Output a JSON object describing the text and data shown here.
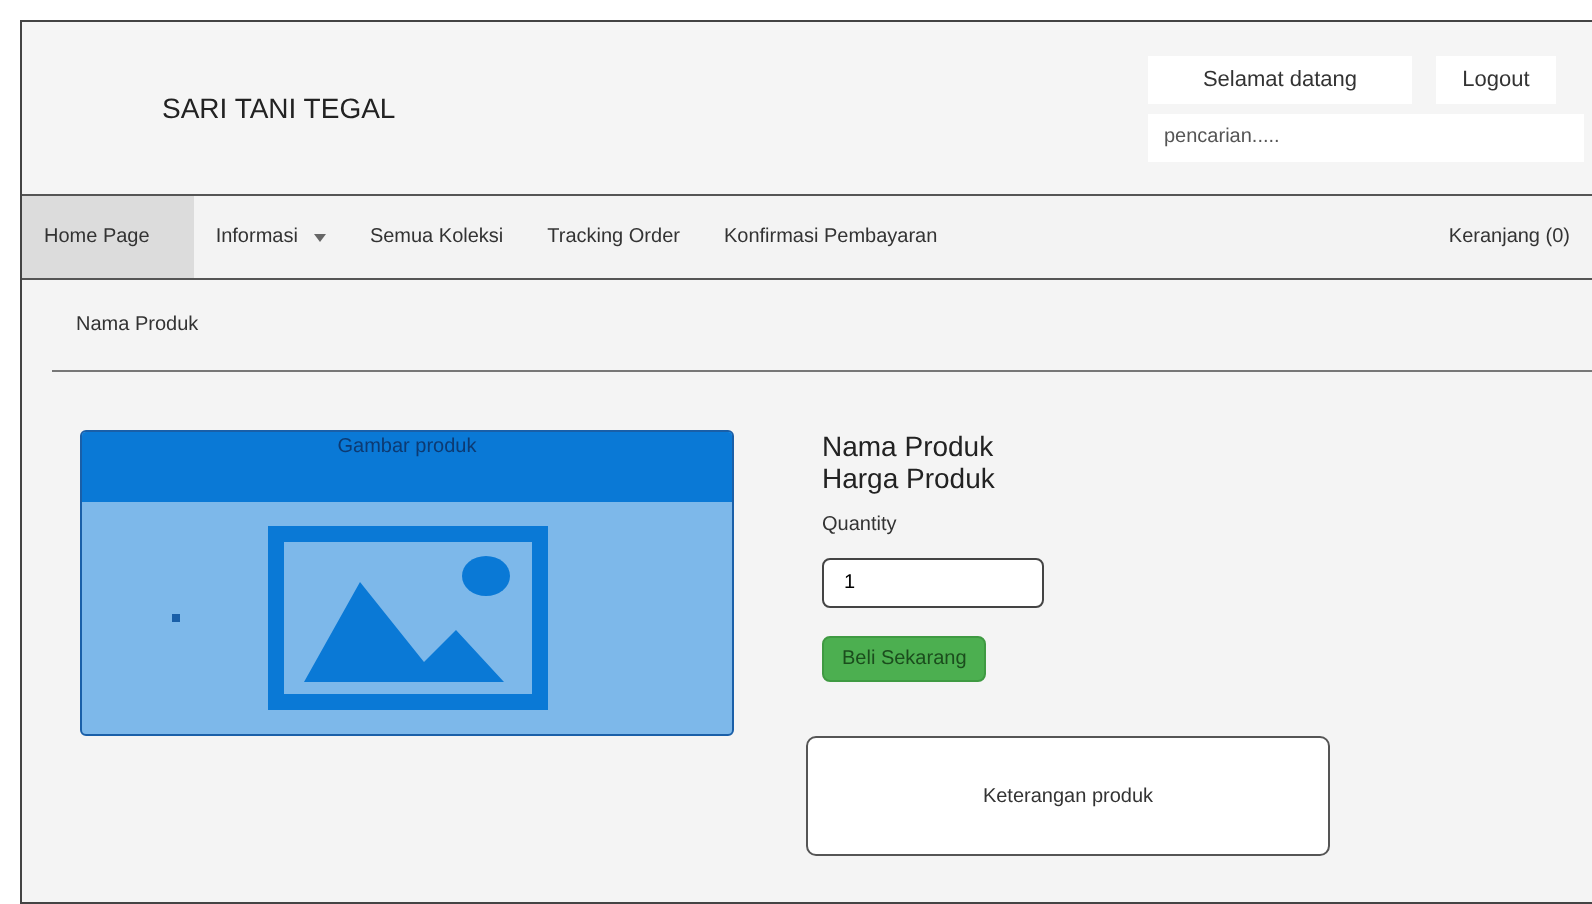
{
  "header": {
    "brand": "SARI TANI TEGAL",
    "welcome": "Selamat datang",
    "logout": "Logout",
    "search": {
      "placeholder": "pencarian....."
    }
  },
  "nav": {
    "items": [
      {
        "label": "Home Page",
        "selected": true,
        "dropdown": false
      },
      {
        "label": "Informasi",
        "selected": false,
        "dropdown": true
      },
      {
        "label": "Semua Koleksi",
        "selected": false,
        "dropdown": false
      },
      {
        "label": "Tracking Order",
        "selected": false,
        "dropdown": false
      },
      {
        "label": "Konfirmasi Pembayaran",
        "selected": false,
        "dropdown": false
      }
    ],
    "cart": "Keranjang (0)"
  },
  "breadcrumb": "Nama Produk",
  "product": {
    "image_title": "Gambar produk",
    "name": "Nama Produk",
    "price": "Harga Produk",
    "quantity_label": "Quantity",
    "quantity": "1",
    "buy": "Beli Sekarang",
    "description": "Keterangan produk"
  }
}
